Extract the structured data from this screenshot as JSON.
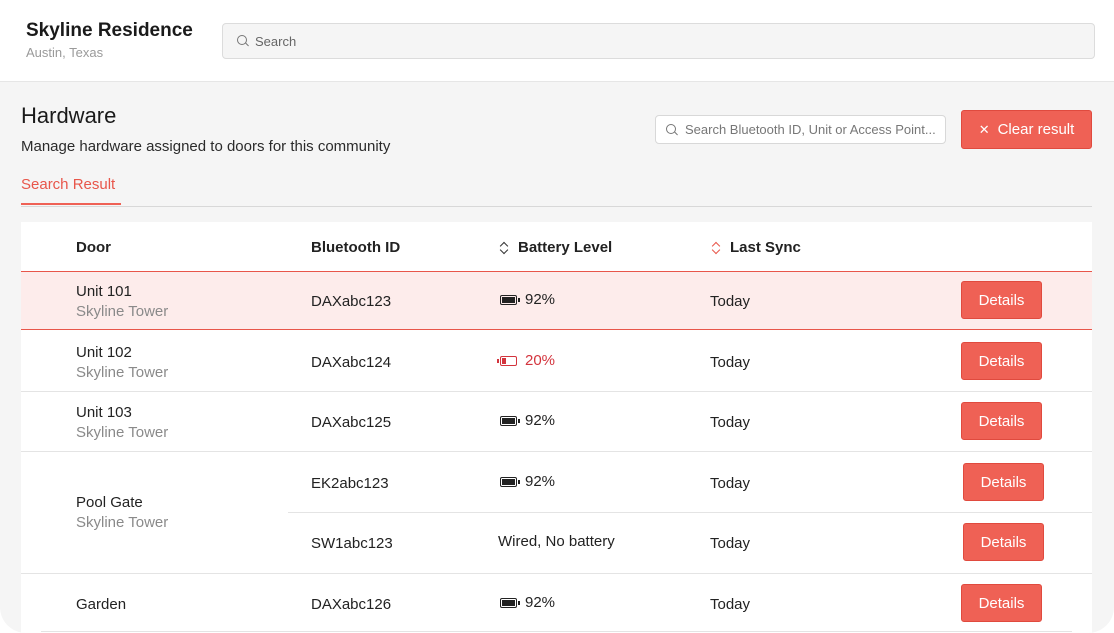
{
  "header": {
    "site_title": "Skyline Residence",
    "site_location": "Austin, Texas",
    "search_placeholder": "Search"
  },
  "page": {
    "title": "Hardware",
    "description": "Manage hardware assigned to doors for this community",
    "hardware_search_placeholder": "Search Bluetooth ID, Unit or Access Point...",
    "clear_button": "Clear result",
    "tab": "Search Result"
  },
  "table": {
    "columns": {
      "door": "Door",
      "bluetooth_id": "Bluetooth ID",
      "battery_level": "Battery Level",
      "last_sync": "Last Sync"
    },
    "details_label": "Details",
    "rows": [
      {
        "door": "Unit 101",
        "building": "Skyline Tower",
        "bluetooth_id": "DAXabc123",
        "battery": "92%",
        "battery_status": "full",
        "last_sync": "Today"
      },
      {
        "door": "Unit 102",
        "building": "Skyline Tower",
        "bluetooth_id": "DAXabc124",
        "battery": "20%",
        "battery_status": "low",
        "last_sync": "Today"
      },
      {
        "door": "Unit 103",
        "building": "Skyline Tower",
        "bluetooth_id": "DAXabc125",
        "battery": "92%",
        "battery_status": "full",
        "last_sync": "Today"
      },
      {
        "door": "Pool Gate",
        "building": "Skyline Tower",
        "devices": [
          {
            "bluetooth_id": "EK2abc123",
            "battery": "92%",
            "battery_status": "full",
            "last_sync": "Today"
          },
          {
            "bluetooth_id": "SW1abc123",
            "battery": "Wired, No battery",
            "battery_status": "wired",
            "last_sync": "Today"
          }
        ]
      },
      {
        "door": "Garden",
        "building": "",
        "bluetooth_id": "DAXabc126",
        "battery": "92%",
        "battery_status": "full",
        "last_sync": "Today"
      }
    ]
  },
  "colors": {
    "accent": "#ef6155",
    "low_battery": "#d3343d",
    "highlight_row": "#fdeceb"
  }
}
